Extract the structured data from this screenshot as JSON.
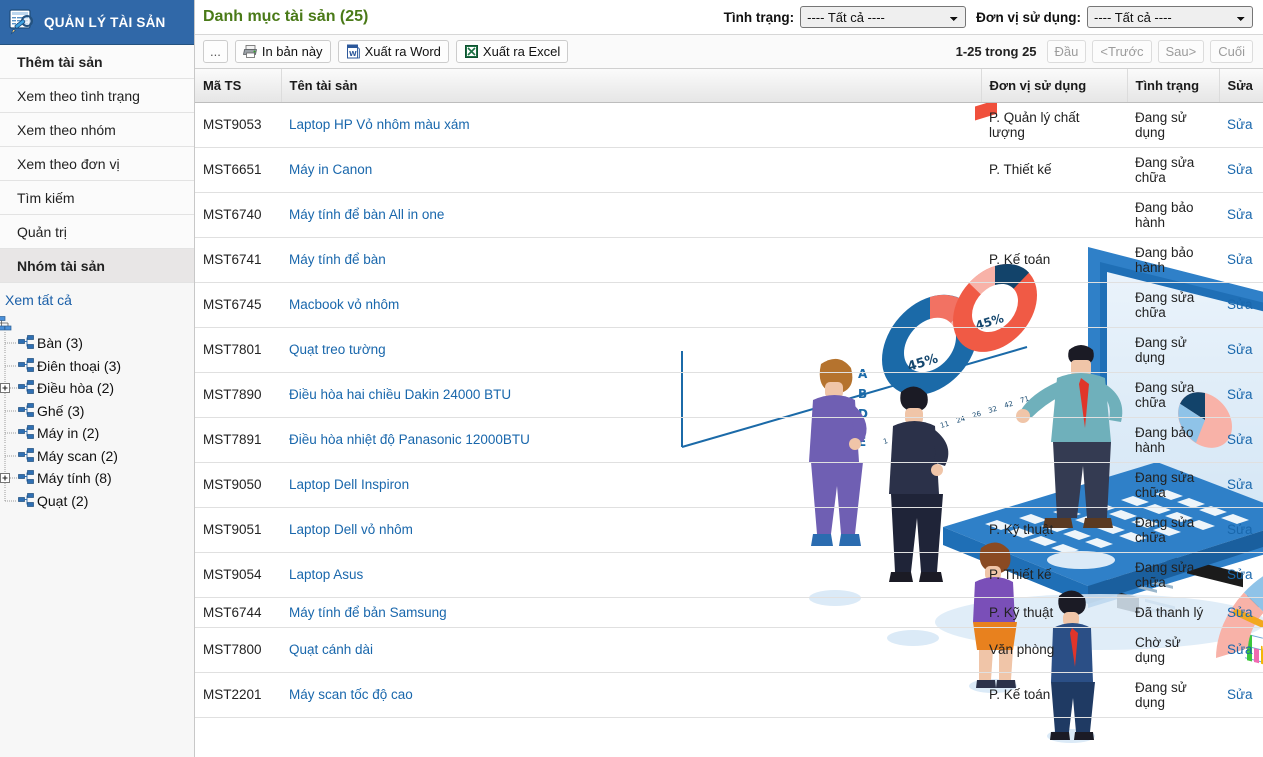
{
  "sidebar": {
    "brand": {
      "icon": "document-search-icon",
      "title": "QUẢN LÝ TÀI SẢN",
      "bg": "#3068a8"
    },
    "nav": [
      {
        "label": "Thêm tài sản",
        "bold": true,
        "active": false
      },
      {
        "label": "Xem theo tình trạng",
        "bold": false,
        "active": false
      },
      {
        "label": "Xem theo nhóm",
        "bold": false,
        "active": false
      },
      {
        "label": "Xem theo đơn vị",
        "bold": false,
        "active": false
      },
      {
        "label": "Tìm kiếm",
        "bold": false,
        "active": false
      },
      {
        "label": "Quản trị",
        "bold": false,
        "active": false
      },
      {
        "label": "Nhóm tài sản",
        "bold": true,
        "active": true
      }
    ],
    "view_all": "Xem tất cả",
    "tree": {
      "root_icon": "sitemap-icon",
      "nodes": [
        {
          "label": "Bàn (3)",
          "expandable": false
        },
        {
          "label": "Điên thoại (3)",
          "expandable": false
        },
        {
          "label": "Điều hòa (2)",
          "expandable": true
        },
        {
          "label": "Ghế (3)",
          "expandable": false
        },
        {
          "label": "Máy in (2)",
          "expandable": false
        },
        {
          "label": "Máy scan (2)",
          "expandable": false
        },
        {
          "label": "Máy tính (8)",
          "expandable": true
        },
        {
          "label": "Quạt (2)",
          "expandable": false
        }
      ]
    }
  },
  "header": {
    "title": "Danh mục tài sản (25)",
    "title_color": "#4a7a18",
    "filters": [
      {
        "label": "Tình trạng:",
        "value": "---- Tất cả ----",
        "name": "status-filter"
      },
      {
        "label": "Đơn vị sử dụng:",
        "value": "---- Tất cả ----",
        "name": "unit-filter"
      }
    ]
  },
  "toolbar": {
    "more_label": "...",
    "buttons": [
      {
        "label": "In bản này",
        "icon": "printer-icon",
        "name": "print-button"
      },
      {
        "label": "Xuất ra Word",
        "icon": "word-icon",
        "name": "export-word-button"
      },
      {
        "label": "Xuất ra Excel",
        "icon": "excel-icon",
        "name": "export-excel-button"
      }
    ],
    "pager": {
      "count": "1-25 trong 25",
      "first": "Đầu",
      "prev": "<Trước",
      "next": "Sau>",
      "last": "Cuối"
    }
  },
  "table": {
    "columns": [
      "Mã TS",
      "Tên tài sản",
      "Đơn vị sử dụng",
      "Tình trạng",
      "Sửa"
    ],
    "edit_label": "Sửa",
    "rows": [
      {
        "code": "MST9053",
        "name": "Laptop HP Vỏ nhôm màu xám",
        "unit": "P. Quản lý chất lượng",
        "status": "Đang sử dụng"
      },
      {
        "code": "MST6651",
        "name": "Máy in Canon",
        "unit": "P. Thiết kế",
        "status": "Đang sửa chữa"
      },
      {
        "code": "MST6740",
        "name": "Máy tính để bàn All in one",
        "unit": "",
        "status": "Đang bảo hành"
      },
      {
        "code": "MST6741",
        "name": "Máy tính để bàn",
        "unit": "P. Kế toán",
        "status": "Đang bảo hành"
      },
      {
        "code": "MST6745",
        "name": "Macbook vỏ nhôm",
        "unit": "",
        "status": "Đang sửa chữa"
      },
      {
        "code": "MST7801",
        "name": "Quạt treo tường",
        "unit": "",
        "status": "Đang sử dụng"
      },
      {
        "code": "MST7890",
        "name": "Điều hòa hai chiều Dakin 24000 BTU",
        "unit": "",
        "status": "Đang sửa chữa"
      },
      {
        "code": "MST7891",
        "name": "Điều hòa nhiệt độ Panasonic 12000BTU",
        "unit": "",
        "status": "Đang bảo hành"
      },
      {
        "code": "MST9050",
        "name": "Laptop Dell Inspiron",
        "unit": "",
        "status": "Đang sửa chữa"
      },
      {
        "code": "MST9051",
        "name": "Laptop Dell vỏ nhôm",
        "unit": "P. Kỹ thuật",
        "status": "Đang sửa chữa"
      },
      {
        "code": "MST9054",
        "name": "Laptop Asus",
        "unit": "P. Thiết kế",
        "status": "Đang sửa chữa"
      },
      {
        "code": "MST6744",
        "name": "Máy tính để bản Samsung",
        "unit": "P. Kỹ thuật",
        "status": "Đã thanh lý"
      },
      {
        "code": "MST7800",
        "name": "Quạt cánh dài",
        "unit": "Văn phòng",
        "status": "Chờ sử dụng"
      },
      {
        "code": "MST2201",
        "name": "Máy scan tốc độ cao",
        "unit": "P. Kế toán",
        "status": "Đang sử dụng"
      }
    ]
  },
  "background": {
    "name": "business-analytics-isometric-illustration",
    "colors": {
      "blue": "#1f6fb6",
      "navy": "#10395c",
      "red": "#f0503c",
      "pink": "#f7b3ab",
      "lightblue": "#a8cdea"
    }
  }
}
